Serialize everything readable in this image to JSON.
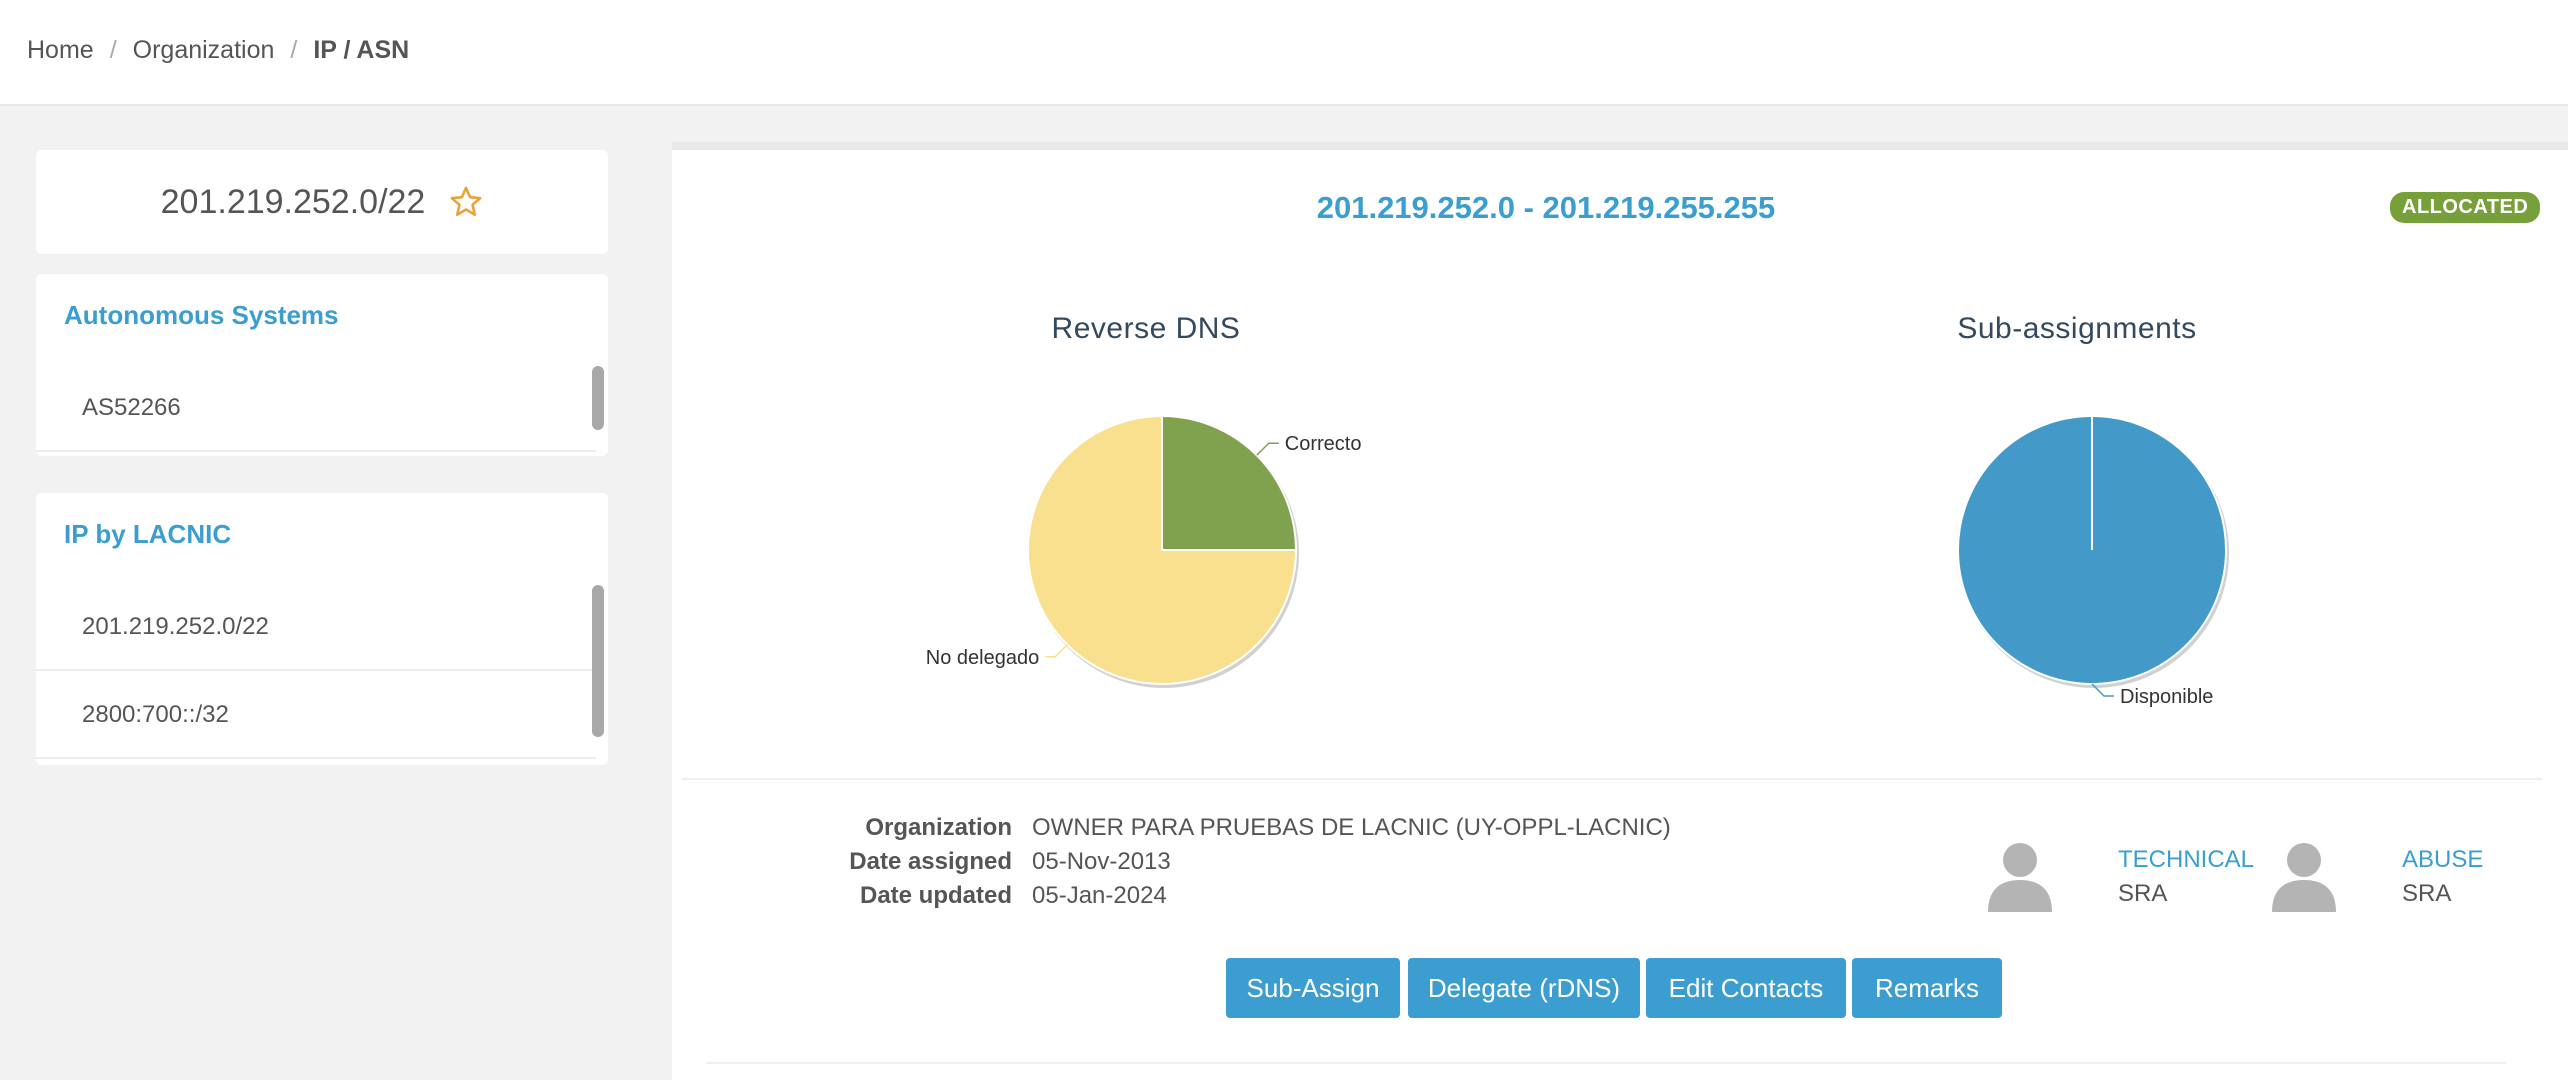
{
  "breadcrumb": {
    "home": "Home",
    "organization": "Organization",
    "current": "IP / ASN",
    "separator": "/"
  },
  "prefix": {
    "title": "201.219.252.0/22",
    "star_icon": "star-outline-icon",
    "star_color": "#e8a23a"
  },
  "autonomous_systems": {
    "title": "Autonomous Systems",
    "items": [
      "AS52266"
    ]
  },
  "ip_by_lacnic": {
    "title": "IP by LACNIC",
    "items": [
      "201.219.252.0/22",
      "2800:700::/32"
    ]
  },
  "main": {
    "range": "201.219.252.0 - 201.219.255.255",
    "status": "ALLOCATED",
    "charts": [
      {
        "title": "Reverse DNS",
        "chart_data": {
          "type": "pie",
          "slices": [
            {
              "label": "Correcto",
              "value": 25,
              "color": "#80a24e"
            },
            {
              "label": "No delegado",
              "value": 75,
              "color": "#f8e08e"
            }
          ]
        }
      },
      {
        "title": "Sub-assignments",
        "chart_data": {
          "type": "pie",
          "slices": [
            {
              "label": "Disponible",
              "value": 100,
              "color": "#4399c8"
            }
          ]
        }
      }
    ],
    "info": {
      "organization_label": "Organization",
      "organization": "OWNER PARA PRUEBAS DE LACNIC (UY-OPPL-LACNIC)",
      "date_assigned_label": "Date assigned",
      "date_assigned": "05-Nov-2013",
      "date_updated_label": "Date updated",
      "date_updated": "05-Jan-2024"
    },
    "contacts": [
      {
        "role": "TECHNICAL",
        "name": "SRA",
        "icon": "user-avatar-icon"
      },
      {
        "role": "ABUSE",
        "name": "SRA",
        "icon": "user-avatar-icon"
      }
    ],
    "buttons": {
      "sub_assign": "Sub-Assign",
      "delegate": "Delegate (rDNS)",
      "edit_contacts": "Edit Contacts",
      "remarks": "Remarks"
    }
  },
  "colors": {
    "accent": "#3b9dd0",
    "badge": "#77a03a",
    "button": "#3b9dd0"
  }
}
